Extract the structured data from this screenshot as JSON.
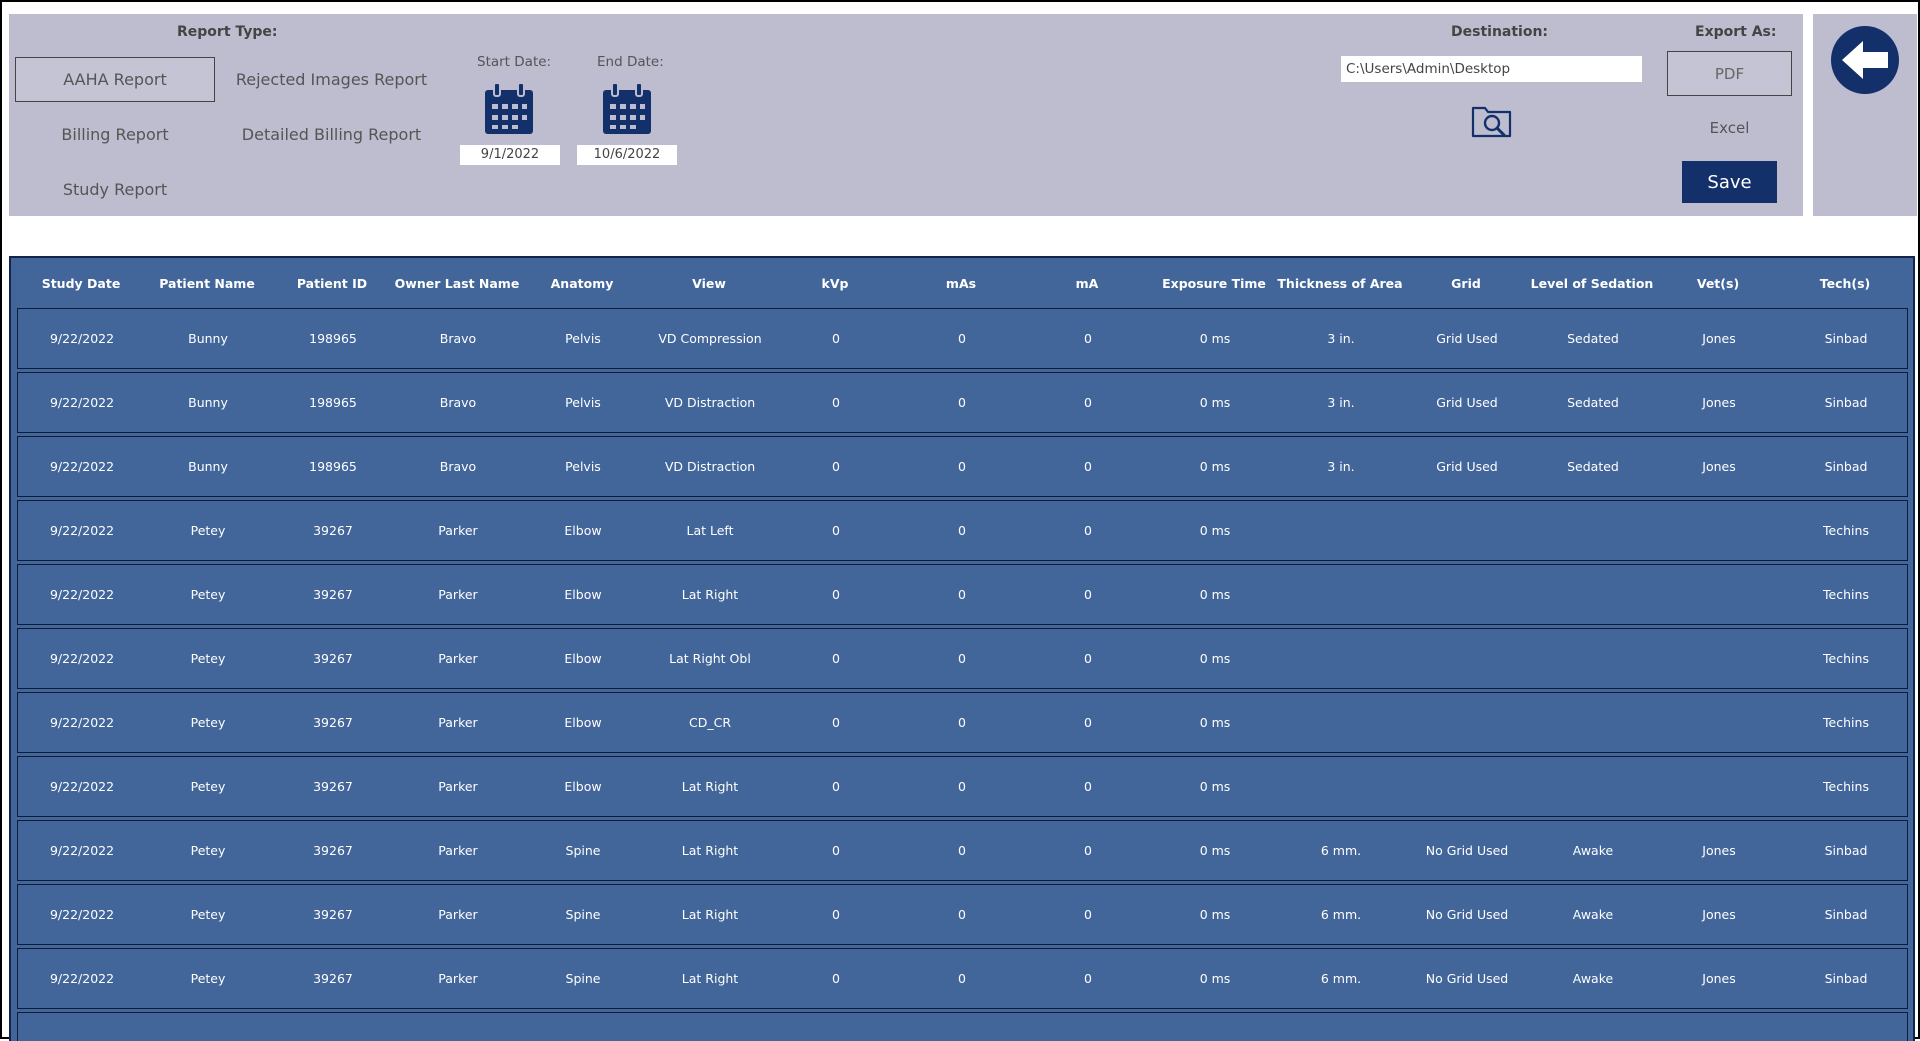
{
  "report_type": {
    "label": "Report Type:",
    "options": [
      "AAHA Report",
      "Rejected Images Report",
      "Billing Report",
      "Detailed Billing Report",
      "Study Report"
    ]
  },
  "start_date": {
    "label": "Start Date:",
    "value": "9/1/2022"
  },
  "end_date": {
    "label": "End Date:",
    "value": "10/6/2022"
  },
  "destination": {
    "label": "Destination:",
    "value": "C:\\Users\\Admin\\Desktop"
  },
  "export": {
    "label": "Export As:",
    "pdf": "PDF",
    "excel": "Excel",
    "save": "Save"
  },
  "colors": {
    "panel": "#bdbdcf",
    "table": "#42669a",
    "accent": "#13306a"
  },
  "icons": {
    "calendar": "calendar-icon",
    "browse": "folder-search-icon",
    "back": "back-arrow-icon"
  },
  "table": {
    "headers": [
      "Study Date",
      "Patient Name",
      "Patient ID",
      "Owner Last Name",
      "Anatomy",
      "View",
      "kVp",
      "mAs",
      "mA",
      "Exposure Time",
      "Thickness of Area",
      "Grid",
      "Level of Sedation",
      "Vet(s)",
      "Tech(s)"
    ],
    "rows": [
      [
        "9/22/2022",
        "Bunny",
        "198965",
        "Bravo",
        "Pelvis",
        "VD Compression",
        "0",
        "0",
        "0",
        "0 ms",
        "3 in.",
        "Grid Used",
        "Sedated",
        "Jones",
        "Sinbad"
      ],
      [
        "9/22/2022",
        "Bunny",
        "198965",
        "Bravo",
        "Pelvis",
        "VD Distraction",
        "0",
        "0",
        "0",
        "0 ms",
        "3 in.",
        "Grid Used",
        "Sedated",
        "Jones",
        "Sinbad"
      ],
      [
        "9/22/2022",
        "Bunny",
        "198965",
        "Bravo",
        "Pelvis",
        "VD Distraction",
        "0",
        "0",
        "0",
        "0 ms",
        "3 in.",
        "Grid Used",
        "Sedated",
        "Jones",
        "Sinbad"
      ],
      [
        "9/22/2022",
        "Petey",
        "39267",
        "Parker",
        "Elbow",
        "Lat Left",
        "0",
        "0",
        "0",
        "0 ms",
        "",
        "",
        "",
        "",
        "Techins"
      ],
      [
        "9/22/2022",
        "Petey",
        "39267",
        "Parker",
        "Elbow",
        "Lat Right",
        "0",
        "0",
        "0",
        "0 ms",
        "",
        "",
        "",
        "",
        "Techins"
      ],
      [
        "9/22/2022",
        "Petey",
        "39267",
        "Parker",
        "Elbow",
        "Lat Right Obl",
        "0",
        "0",
        "0",
        "0 ms",
        "",
        "",
        "",
        "",
        "Techins"
      ],
      [
        "9/22/2022",
        "Petey",
        "39267",
        "Parker",
        "Elbow",
        "CD_CR",
        "0",
        "0",
        "0",
        "0 ms",
        "",
        "",
        "",
        "",
        "Techins"
      ],
      [
        "9/22/2022",
        "Petey",
        "39267",
        "Parker",
        "Elbow",
        "Lat Right",
        "0",
        "0",
        "0",
        "0 ms",
        "",
        "",
        "",
        "",
        "Techins"
      ],
      [
        "9/22/2022",
        "Petey",
        "39267",
        "Parker",
        "Spine",
        "Lat Right",
        "0",
        "0",
        "0",
        "0 ms",
        "6 mm.",
        "No Grid Used",
        "Awake",
        "Jones",
        "Sinbad"
      ],
      [
        "9/22/2022",
        "Petey",
        "39267",
        "Parker",
        "Spine",
        "Lat Right",
        "0",
        "0",
        "0",
        "0 ms",
        "6 mm.",
        "No Grid Used",
        "Awake",
        "Jones",
        "Sinbad"
      ],
      [
        "9/22/2022",
        "Petey",
        "39267",
        "Parker",
        "Spine",
        "Lat Right",
        "0",
        "0",
        "0",
        "0 ms",
        "6 mm.",
        "No Grid Used",
        "Awake",
        "Jones",
        "Sinbad"
      ],
      [
        "",
        "",
        "",
        "",
        "",
        "",
        "",
        "",
        "",
        "",
        "",
        "",
        "",
        "",
        ""
      ]
    ]
  }
}
